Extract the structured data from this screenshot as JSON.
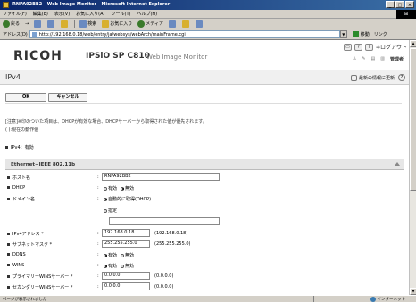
{
  "window": {
    "title": "RNPA92BB2 - Web Image Monitor - Microsoft Internet Explorer",
    "min": "_",
    "max": "□",
    "close": "×"
  },
  "menu": [
    "ファイル(F)",
    "編集(E)",
    "表示(V)",
    "お気に入り(A)",
    "ツール(T)",
    "ヘルプ(H)"
  ],
  "toolbar": {
    "back": "戻る",
    "forward": "→",
    "search": "検索",
    "favorites": "お気に入り",
    "media": "メディア"
  },
  "address": {
    "label": "アドレス(D)",
    "url": "http://192.168.0.18/web/entry/ja/websys/webArch/mainFrame.cgi",
    "go": "移動",
    "links": "リンク"
  },
  "header": {
    "brand": "RICOH",
    "model": "IPSiO SP C810",
    "product": "Web Image Monitor",
    "logout": "ログアウト",
    "admin": "管理者",
    "help_icon": "?",
    "home_icon": "i",
    "cat_icon": "▭"
  },
  "page": {
    "title": "IPv4",
    "refresh": "最新の情報に更新",
    "help": "?",
    "ok": "OK",
    "cancel": "キャンセル",
    "note1": "[注意]※印のついた項目は、DHCPが有効な場合、DHCPサーバーから取得された値が優先されます。",
    "note2": "( ):現在の動作値",
    "ipv4_status": "IPv4：有効"
  },
  "section": {
    "title": "Ethernet+IEEE 802.11b",
    "host_label": "ホスト名",
    "host_value": "RNPA92BB2",
    "dhcp_label": "DHCP",
    "dhcp_on": "有効",
    "dhcp_off": "無効",
    "domain_label": "ドメイン名",
    "domain_auto": "自動的に取得(DHCP)",
    "domain_manual": "指定",
    "domain_value": "",
    "ip_label": "IPv4アドレス *",
    "ip_value": "192.168.0.18",
    "ip_current": "(192.168.0.18)",
    "mask_label": "サブネットマスク *",
    "mask_value": "255.255.255.0",
    "mask_current": "(255.255.255.0)",
    "ddns_label": "DDNS",
    "ddns_on": "有効",
    "ddns_off": "無効",
    "wins_label": "WINS",
    "wins_on": "有効",
    "wins_off": "無効",
    "pwins_label": "プライマリーWINSサーバー *",
    "pwins_value": "0.0.0.0",
    "pwins_current": "(0.0.0.0)",
    "swins_label": "セカンダリーWINSサーバー *",
    "swins_value": "0.0.0.0",
    "swins_current": "(0.0.0.0)",
    "colon": ":"
  },
  "status": {
    "text": "ページが表示されました",
    "zone": "インターネット"
  }
}
